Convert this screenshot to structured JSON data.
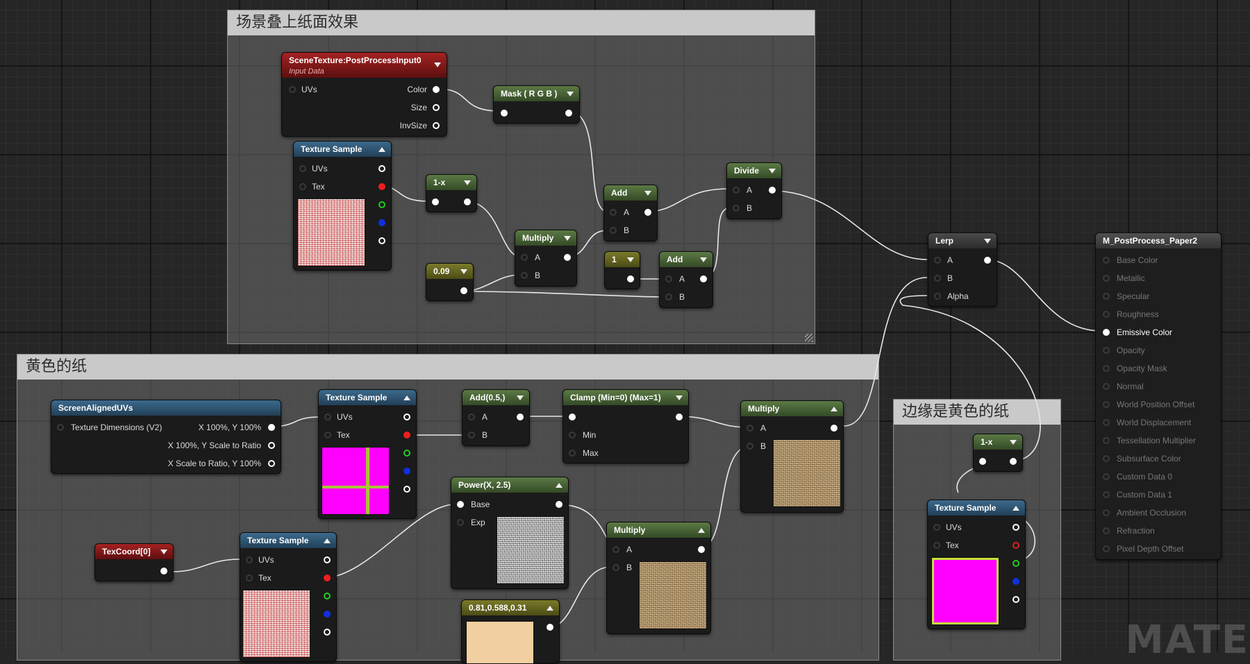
{
  "comments": {
    "scene": "场景叠上纸面效果",
    "yellow": "黄色的纸",
    "edge": "边缘是黄色的纸"
  },
  "nodes": {
    "scene_texture": {
      "title": "SceneTexture:PostProcessInput0",
      "subtitle": "Input Data",
      "in_uvs": "UVs",
      "out_color": "Color",
      "out_size": "Size",
      "out_invsize": "InvSize"
    },
    "mask": {
      "title": "Mask ( R G B )"
    },
    "tex_sample_1": {
      "title": "Texture Sample",
      "uvs": "UVs",
      "tex": "Tex"
    },
    "one_minus_1": {
      "title": "1-x"
    },
    "const_009": {
      "title": "0.09"
    },
    "multiply_1": {
      "title": "Multiply",
      "a": "A",
      "b": "B"
    },
    "add_1": {
      "title": "Add",
      "a": "A",
      "b": "B"
    },
    "const_1": {
      "title": "1"
    },
    "add_2": {
      "title": "Add",
      "a": "A",
      "b": "B"
    },
    "divide": {
      "title": "Divide",
      "a": "A",
      "b": "B"
    },
    "lerp": {
      "title": "Lerp",
      "a": "A",
      "b": "B",
      "alpha": "Alpha"
    },
    "screen_uvs": {
      "title": "ScreenAlignedUVs",
      "in_dim": "Texture Dimensions (V2)",
      "out1": "X 100%, Y 100%",
      "out2": "X 100%, Y Scale to Ratio",
      "out3": "X Scale to Ratio, Y 100%"
    },
    "tex_sample_2": {
      "title": "Texture Sample",
      "uvs": "UVs",
      "tex": "Tex"
    },
    "add_05": {
      "title": "Add(0.5,)",
      "a": "A",
      "b": "B"
    },
    "clamp": {
      "title": "Clamp (Min=0) (Max=1)",
      "min": "Min",
      "max": "Max"
    },
    "multiply_2": {
      "title": "Multiply",
      "a": "A",
      "b": "B"
    },
    "power": {
      "title": "Power(X, 2.5)",
      "base": "Base",
      "exp": "Exp"
    },
    "multiply_3": {
      "title": "Multiply",
      "a": "A",
      "b": "B"
    },
    "texcoord": {
      "title": "TexCoord[0]"
    },
    "tex_sample_3": {
      "title": "Texture Sample",
      "uvs": "UVs",
      "tex": "Tex"
    },
    "const_color": {
      "title": "0.81,0.588,0.31"
    },
    "one_minus_2": {
      "title": "1-x"
    },
    "tex_sample_4": {
      "title": "Texture Sample",
      "uvs": "UVs",
      "tex": "Tex"
    }
  },
  "output_node": {
    "title": "M_PostProcess_Paper2",
    "pins": [
      "Base Color",
      "Metallic",
      "Specular",
      "Roughness",
      "Emissive Color",
      "Opacity",
      "Opacity Mask",
      "Normal",
      "World Position Offset",
      "World Displacement",
      "Tessellation Multiplier",
      "Subsurface Color",
      "Custom Data 0",
      "Custom Data 1",
      "Ambient Occlusion",
      "Refraction",
      "Pixel Depth Offset"
    ],
    "active_pin": "Emissive Color"
  },
  "watermark": "MATER",
  "colors": {
    "magenta": "#ff00ff",
    "peach": "#f1cfa0",
    "pin_red": "#f01e1e",
    "pin_green": "#22cc22",
    "pin_blue": "#1030e0"
  }
}
